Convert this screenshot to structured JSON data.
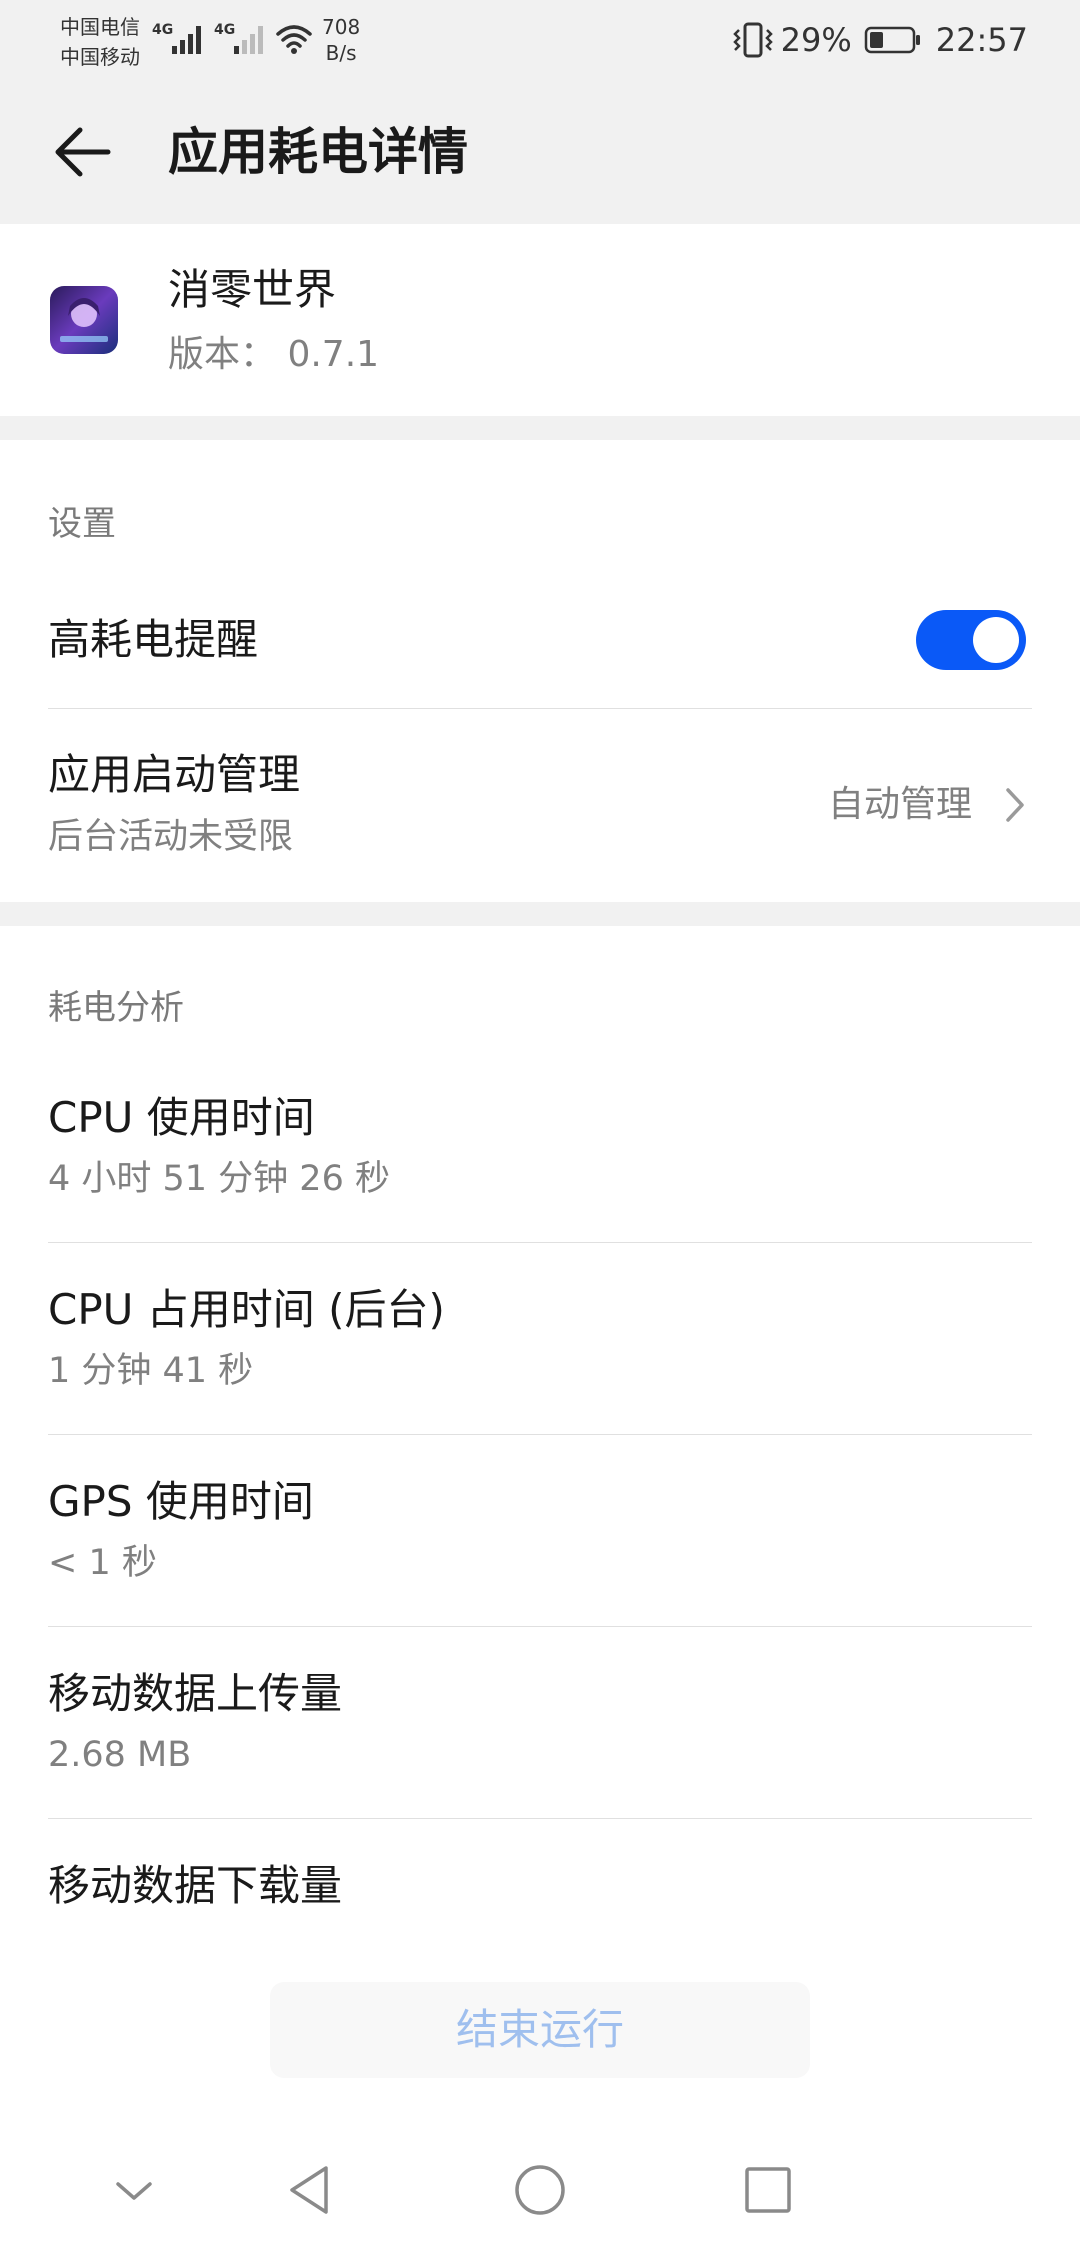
{
  "status_bar": {
    "carrier_1": "中国电信",
    "carrier_2": "中国移动",
    "network_1": "4G",
    "network_2": "4G",
    "speed_value": "708",
    "speed_unit": "B/s",
    "battery_percent": "29%",
    "time": "22:57"
  },
  "header": {
    "title": "应用耗电详情"
  },
  "app": {
    "name": "消零世界",
    "version": "版本：  0.7.1"
  },
  "settings": {
    "section_title": "设置",
    "high_drain_alert_label": "高耗电提醒",
    "high_drain_alert_enabled": true,
    "launch_management_label": "应用启动管理",
    "launch_management_sub": "后台活动未受限",
    "launch_management_value": "自动管理"
  },
  "analysis": {
    "section_title": "耗电分析",
    "items": [
      {
        "label": "CPU 使用时间",
        "value": "4 小时 51 分钟 26 秒"
      },
      {
        "label": "CPU 占用时间 (后台)",
        "value": "1 分钟 41 秒"
      },
      {
        "label": "GPS 使用时间",
        "value": "< 1 秒"
      },
      {
        "label": "移动数据上传量",
        "value": "2.68 MB"
      },
      {
        "label": "移动数据下载量",
        "value": ""
      }
    ]
  },
  "end_button_label": "结束运行",
  "colors": {
    "accent": "#0a59f7",
    "background": "#f1f1f1",
    "disabled_text": "#9fbfee"
  }
}
